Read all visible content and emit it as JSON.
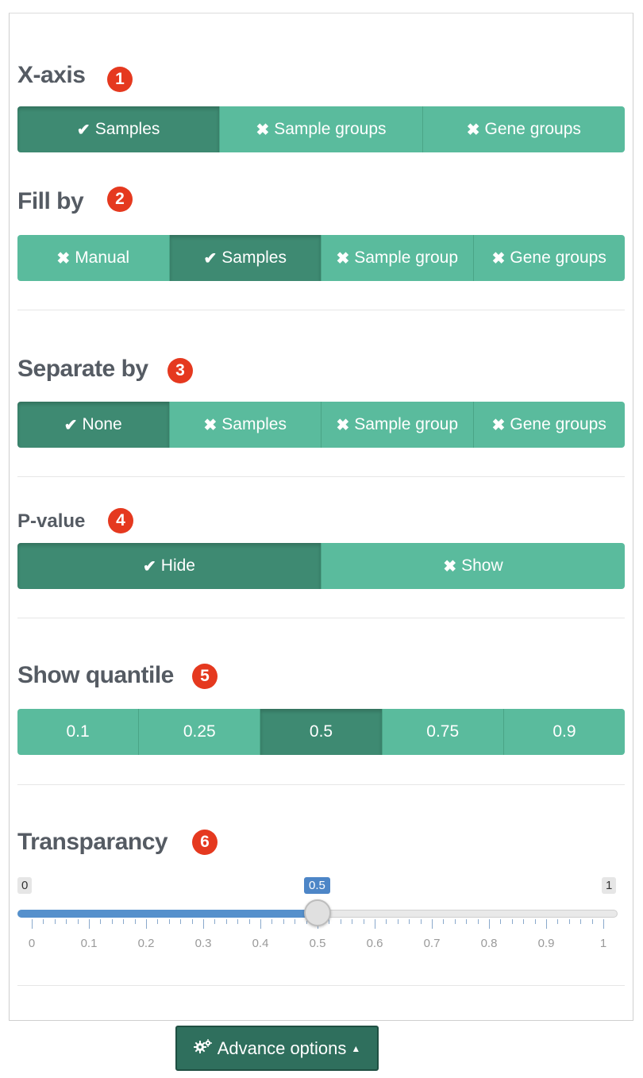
{
  "sections": {
    "xaxis": {
      "title": "X-axis",
      "badge": "1",
      "options": [
        {
          "icon": "✔",
          "label": "Samples",
          "active": true
        },
        {
          "icon": "✖",
          "label": "Sample groups",
          "active": false
        },
        {
          "icon": "✖",
          "label": "Gene groups",
          "active": false
        }
      ]
    },
    "fillby": {
      "title": "Fill by",
      "badge": "2",
      "options": [
        {
          "icon": "✖",
          "label": "Manual",
          "active": false
        },
        {
          "icon": "✔",
          "label": "Samples",
          "active": true
        },
        {
          "icon": "✖",
          "label": "Sample group",
          "active": false
        },
        {
          "icon": "✖",
          "label": "Gene groups",
          "active": false
        }
      ]
    },
    "separateby": {
      "title": "Separate by",
      "badge": "3",
      "options": [
        {
          "icon": "✔",
          "label": "None",
          "active": true
        },
        {
          "icon": "✖",
          "label": "Samples",
          "active": false
        },
        {
          "icon": "✖",
          "label": "Sample group",
          "active": false
        },
        {
          "icon": "✖",
          "label": "Gene groups",
          "active": false
        }
      ]
    },
    "pvalue": {
      "title": "P-value",
      "badge": "4",
      "options": [
        {
          "icon": "✔",
          "label": "Hide",
          "active": true
        },
        {
          "icon": "✖",
          "label": "Show",
          "active": false
        }
      ]
    },
    "quantile": {
      "title": "Show quantile",
      "badge": "5",
      "options": [
        {
          "label": "0.1",
          "active": false
        },
        {
          "label": "0.25",
          "active": false
        },
        {
          "label": "0.5",
          "active": true
        },
        {
          "label": "0.75",
          "active": false
        },
        {
          "label": "0.9",
          "active": false
        }
      ]
    },
    "transparancy": {
      "title": "Transparancy",
      "badge": "6",
      "slider": {
        "min_label": "0",
        "max_label": "1",
        "value_label": "0.5",
        "value": 0.5,
        "ticks": [
          "0",
          "0.1",
          "0.2",
          "0.3",
          "0.4",
          "0.5",
          "0.6",
          "0.7",
          "0.8",
          "0.9",
          "1"
        ]
      }
    }
  },
  "advance_button": {
    "label": "Advance options",
    "icon": "gears-icon"
  },
  "colors": {
    "button": "#5abb9d",
    "button_active": "#3e8a72",
    "badge": "#e5391f",
    "slider_fill": "#5590cc"
  }
}
